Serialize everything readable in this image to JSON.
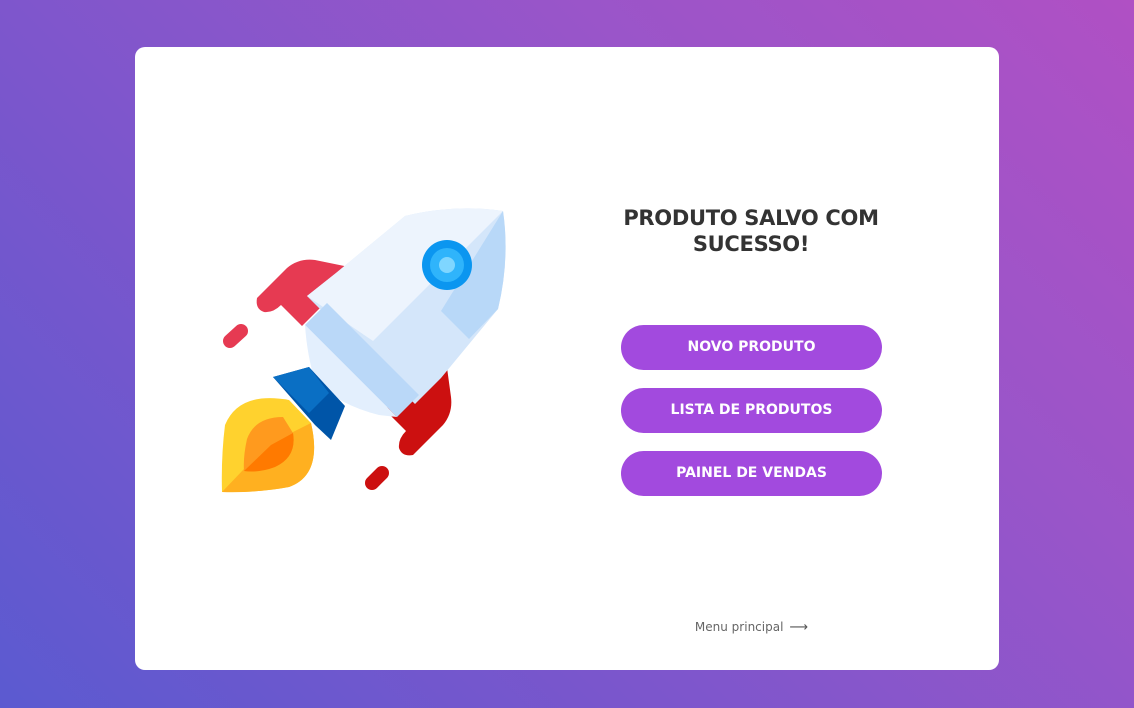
{
  "card": {
    "title": "PRODUTO SALVO COM SUCESSO!"
  },
  "buttons": {
    "new_product": "NOVO PRODUTO",
    "product_list": "LISTA DE PRODUTOS",
    "sales_panel": "PAINEL DE VENDAS"
  },
  "footer": {
    "menu_link": "Menu principal",
    "arrow_glyph": "⟶"
  },
  "illustration": {
    "icon": "rocket-icon"
  },
  "colors": {
    "button": "#a24ade",
    "title": "#333333"
  }
}
